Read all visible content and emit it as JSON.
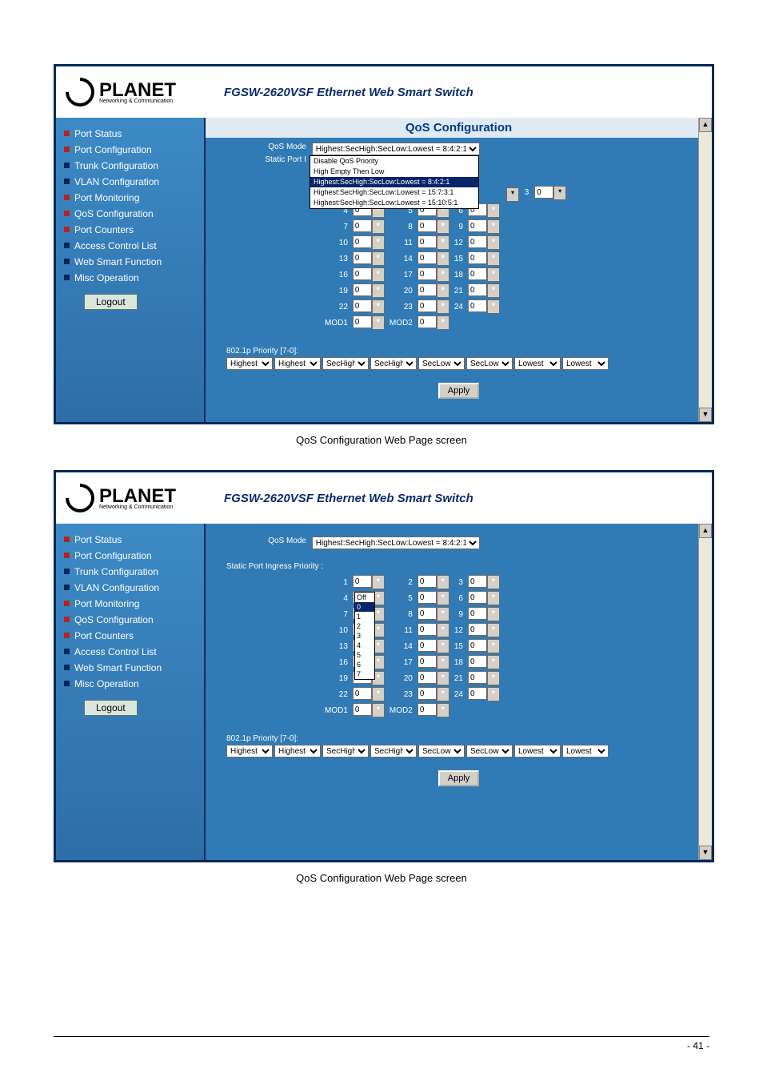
{
  "banner": {
    "logo_text": "PLANET",
    "logo_sub": "Networking & Communication",
    "title": "FGSW-2620VSF Ethernet Web Smart Switch"
  },
  "sidebar": {
    "items": [
      {
        "label": "Port Status",
        "color": "#b22424"
      },
      {
        "label": "Port Configuration",
        "color": "#b22424"
      },
      {
        "label": "Trunk Configuration",
        "color": "#08265c"
      },
      {
        "label": "VLAN Configuration",
        "color": "#08265c"
      },
      {
        "label": "Port Monitoring",
        "color": "#b22424"
      },
      {
        "label": "QoS Configuration",
        "color": "#b22424"
      },
      {
        "label": "Port Counters",
        "color": "#b22424"
      },
      {
        "label": "Access Control List",
        "color": "#08265c"
      },
      {
        "label": "Web Smart Function",
        "color": "#08265c"
      },
      {
        "label": "Misc Operation",
        "color": "#08265c"
      }
    ],
    "logout": "Logout"
  },
  "panel_title": "QoS Configuration",
  "panel1": {
    "mode_label": "QoS Mode",
    "mode_value": "Highest:SecHigh:SecLow:Lowest = 8:4:2:1",
    "static_label": "Static Port I",
    "mode_options": [
      "Disable QoS Priority",
      "High Empty Then Low",
      "Highest:SecHigh:SecLow:Lowest = 8:4:2:1",
      "Highest:SecHigh:SecLow:Lowest = 15:7:3:1",
      "Highest:SecHigh:SecLow:Lowest = 15:10:5:1"
    ],
    "ports_head_col3": "3",
    "rows": [
      [
        "4",
        "0",
        "5",
        "0",
        "6",
        "0"
      ],
      [
        "7",
        "0",
        "8",
        "0",
        "9",
        "0"
      ],
      [
        "10",
        "0",
        "11",
        "0",
        "12",
        "0"
      ],
      [
        "13",
        "0",
        "14",
        "0",
        "15",
        "0"
      ],
      [
        "16",
        "0",
        "17",
        "0",
        "18",
        "0"
      ],
      [
        "19",
        "0",
        "20",
        "0",
        "21",
        "0"
      ],
      [
        "22",
        "0",
        "23",
        "0",
        "24",
        "0"
      ],
      [
        "MOD1",
        "0",
        "MOD2",
        "0",
        "",
        ""
      ]
    ]
  },
  "panel2": {
    "mode_label": "QoS Mode",
    "mode_value": "Highest:SecHigh:SecLow:Lowest = 8:4:2:1",
    "static_label": "Static Port Ingress Priority :",
    "rows": [
      [
        "1",
        "0",
        "2",
        "0",
        "3",
        "0"
      ],
      [
        "4",
        "Off",
        "5",
        "0",
        "6",
        "0"
      ],
      [
        "7",
        "",
        "8",
        "0",
        "9",
        "0"
      ],
      [
        "10",
        "",
        "11",
        "0",
        "12",
        "0"
      ],
      [
        "13",
        "",
        "14",
        "0",
        "15",
        "0"
      ],
      [
        "16",
        "",
        "17",
        "0",
        "18",
        "0"
      ],
      [
        "19",
        "0",
        "20",
        "0",
        "21",
        "0"
      ],
      [
        "22",
        "0",
        "23",
        "0",
        "24",
        "0"
      ],
      [
        "MOD1",
        "0",
        "MOD2",
        "0",
        "",
        ""
      ]
    ],
    "sub_options": [
      "Off",
      "0",
      "1",
      "2",
      "3",
      "4",
      "5",
      "6",
      "7"
    ]
  },
  "prio": {
    "label": "802.1p Priority [7-0]:",
    "values": [
      "Highest",
      "Highest",
      "SecHigh",
      "SecHigh",
      "SecLow",
      "SecLow",
      "Lowest",
      "Lowest"
    ]
  },
  "apply": "Apply",
  "caption": "QoS Configuration Web Page screen",
  "footer": "- 41 -"
}
